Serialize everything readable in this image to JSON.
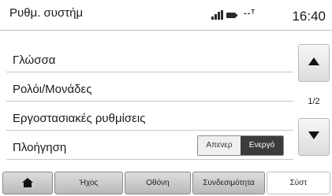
{
  "header": {
    "title": "Ρυθμ. συστήμ",
    "network": "--ᵀ",
    "time": "16:40"
  },
  "menu": {
    "items": [
      {
        "label": "Γλώσσα"
      },
      {
        "label": "Ρολόι/Μονάδες"
      },
      {
        "label": "Εργοστασιακές ρυθμίσεις"
      },
      {
        "label": "Πλοήγηση"
      }
    ],
    "navigation_toggle": {
      "off_label": "Απενερ",
      "on_label": "Ενεργό",
      "selected": "Ενεργό"
    }
  },
  "scroll": {
    "page": "1/2"
  },
  "tabs": [
    {
      "label": "",
      "icon": "home-icon"
    },
    {
      "label": "Ήχος"
    },
    {
      "label": "Οθόνη"
    },
    {
      "label": "Συνδεσιμότητα"
    },
    {
      "label": "Σύστ",
      "active": true
    }
  ]
}
